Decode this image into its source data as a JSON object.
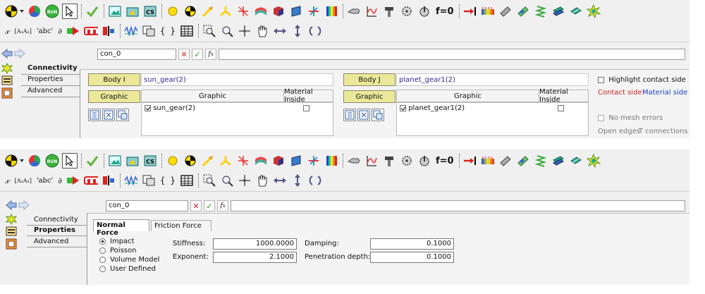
{
  "toolbar": {
    "icons": [
      "pointer-select-icon",
      "color-wheel-icon",
      "run-icon",
      "arrow-cursor-icon",
      "check-icon",
      "image-icon",
      "folder-icon",
      "cs-icon",
      "point-icon",
      "marker-icon",
      "arrow-icon",
      "joint-icon",
      "spring-icon",
      "surface-icon",
      "solid-icon",
      "plane-icon",
      "axes-icon",
      "contour-icon",
      "pump-icon",
      "graph-icon",
      "joint-tool-icon",
      "gear-icon",
      "dial-icon",
      "f0",
      "force-arrow-icon",
      "ruler-icon",
      "cylinder-icon",
      "beam-icon",
      "spring-icon",
      "plate-icon",
      "star-icon"
    ],
    "run_label": "RUN",
    "cs_label": "CS",
    "f0_label": "f=0",
    "row2": {
      "script_label": "𝓍",
      "abc_bracket_label": "[A₁A₂]",
      "abc_label": "'abc'",
      "derivative_label": "∂",
      "braces_label": "{ }"
    }
  },
  "panel1": {
    "name_value": "con_0",
    "tabs": [
      "Connectivity",
      "Properties",
      "Advanced"
    ],
    "active_tab": "Connectivity",
    "body_i": {
      "button": "Body I",
      "value": "sun_gear(2)"
    },
    "body_j": {
      "button": "Body J",
      "value": "planet_gear1(2)"
    },
    "graphic_button": "Graphic",
    "graphic_header": "Graphic",
    "material_inside_header": "Material Inside",
    "graphic_i_row": "sun_gear(2)",
    "graphic_j_row": "planet_gear1(2)",
    "highlight_contact_side": "Highlight contact side",
    "contact_side": "Contact side",
    "material_side": "Material side",
    "no_mesh_errors": "No mesh errors",
    "open_edges": "Open edges",
    "t_connections": "T connections",
    "colors": {
      "contact_side": "#cc2020",
      "material_side": "#1c3cc4",
      "body_value": "#2b2b9a",
      "yellow_btn": "#ece89a"
    }
  },
  "panel2": {
    "name_value": "con_0",
    "tabs": [
      "Connectivity",
      "Properties",
      "Advanced"
    ],
    "active_tab": "Properties",
    "subtabs": [
      "Normal Force",
      "Friction Force"
    ],
    "active_subtab": "Normal Force",
    "radio_options": [
      "Impact",
      "Poisson",
      "Volume Model",
      "User Defined"
    ],
    "selected_radio": "Impact",
    "stiffness_label": "Stiffness:",
    "stiffness_value": "1000.0000",
    "exponent_label": "Exponent:",
    "exponent_value": "2.1000",
    "damping_label": "Damping:",
    "damping_value": "0.1000",
    "penetration_label": "Penetration depth:",
    "penetration_value": "0.1000"
  }
}
